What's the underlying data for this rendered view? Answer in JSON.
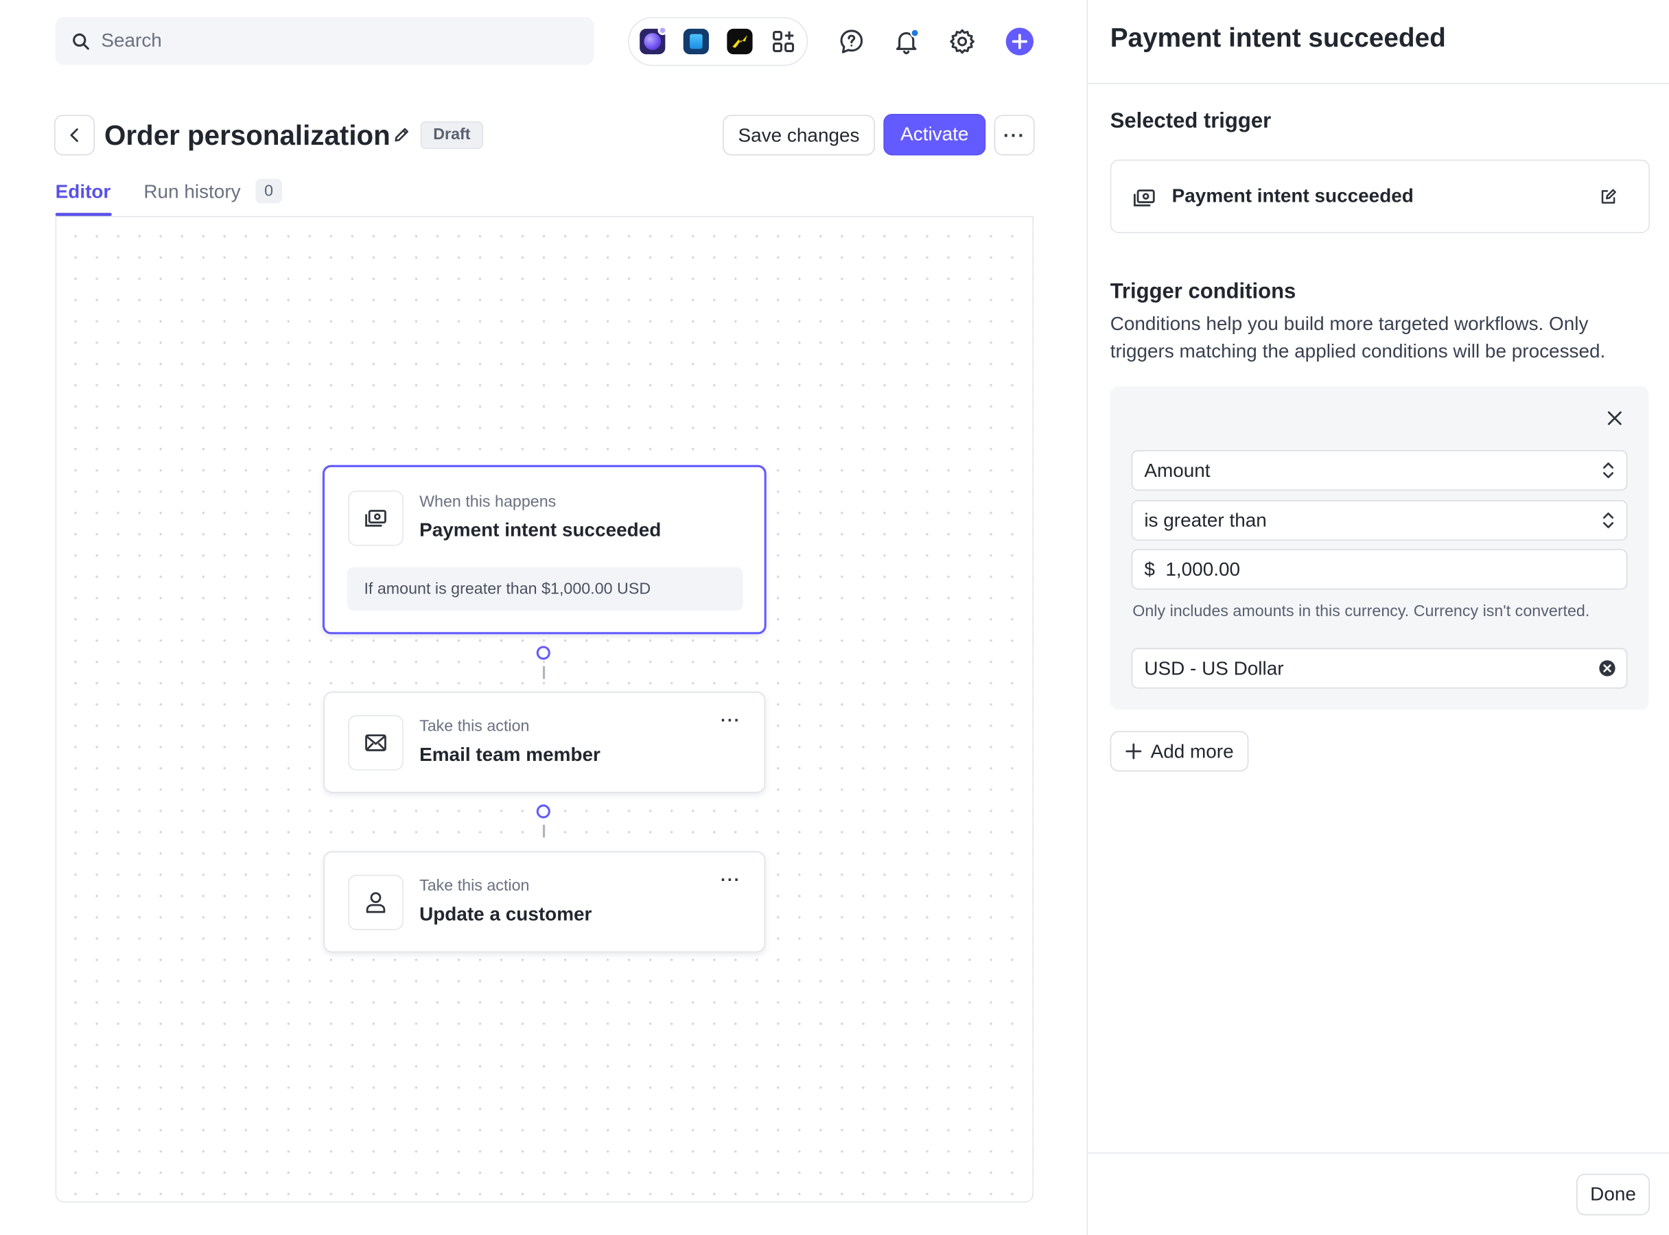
{
  "topbar": {
    "search_placeholder": "Search",
    "apps": [
      "purple-orb-app-icon",
      "blue-cube-app-icon",
      "lightning-app-icon",
      "apps-grid-icon"
    ],
    "icons": [
      "help-icon",
      "notifications-icon",
      "settings-icon",
      "create-plus-icon"
    ],
    "accent": "#635bff"
  },
  "header": {
    "title": "Order personalization",
    "status": "Draft",
    "save_label": "Save changes",
    "activate_label": "Activate",
    "more_label": "···"
  },
  "tabs": {
    "editor": "Editor",
    "run_history": "Run history",
    "run_count": "0"
  },
  "workflow": {
    "trigger": {
      "caption": "When this happens",
      "name": "Payment intent succeeded",
      "condition": "If amount is greater than $1,000.00 USD"
    },
    "actions": [
      {
        "caption": "Take this action",
        "name": "Email team member",
        "icon": "mail-icon"
      },
      {
        "caption": "Take this action",
        "name": "Update a customer",
        "icon": "person-icon"
      }
    ],
    "menu_dots": "···"
  },
  "panel": {
    "title": "Payment intent succeeded",
    "selected_trigger_heading": "Selected trigger",
    "selected_trigger_name": "Payment intent succeeded",
    "conditions_heading": "Trigger conditions",
    "conditions_desc": "Conditions help you build more targeted workflows. Only triggers matching the applied conditions will be processed.",
    "field": "Amount",
    "operator": "is greater than",
    "amount_value": "$  1,000.00",
    "currency_help": "Only includes amounts in this currency. Currency isn't converted.",
    "currency": "USD - US Dollar",
    "add_more_label": "Add more",
    "done_label": "Done"
  }
}
